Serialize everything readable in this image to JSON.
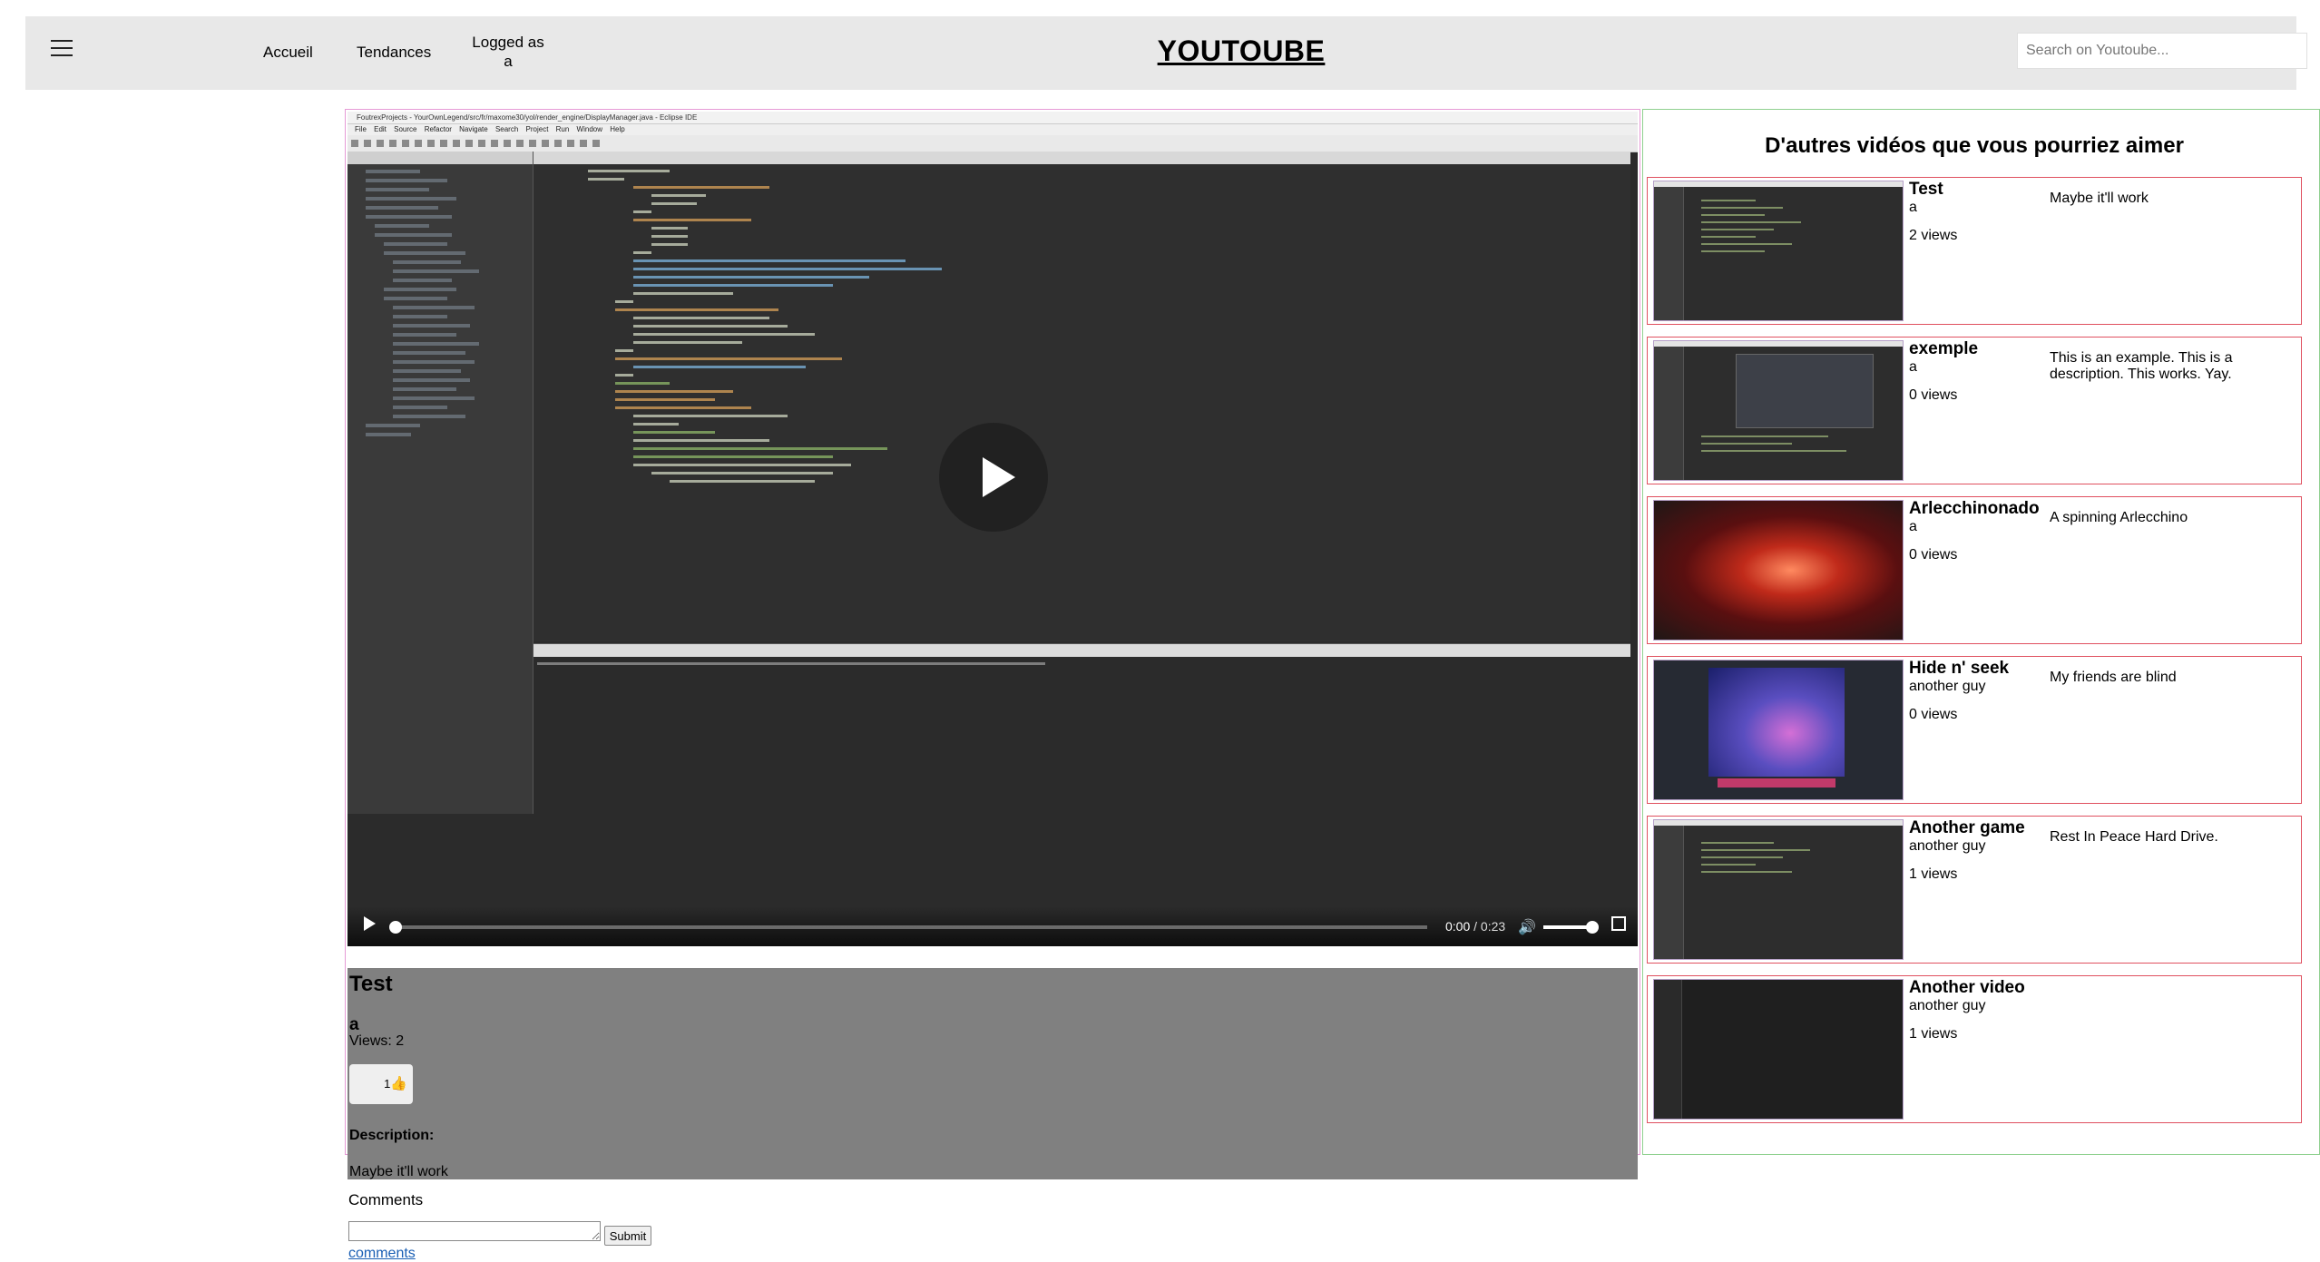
{
  "header": {
    "nav": {
      "home": "Accueil",
      "trending": "Tendances",
      "logged": "Logged as a"
    },
    "logo": "YOUTOUBE",
    "search_placeholder": "Search on Youtoube..."
  },
  "player": {
    "window_title": "FoutrexProjects - YourOwnLegend/src/fr/maxome30/yol/render_engine/DisplayManager.java - Eclipse IDE",
    "window_menu": "File Edit Source Refactor Navigate Search Project Run Window Help",
    "current_time": "0:00",
    "duration": "0:23",
    "progress": 0.0,
    "volume": 1.0
  },
  "video": {
    "title": "Test",
    "author": "a",
    "views": "Views: 2",
    "likes": "1",
    "description_label": "Description:",
    "description": "Maybe it'll work"
  },
  "comments": {
    "label": "Comments",
    "submit": "Submit",
    "link": "comments"
  },
  "sidebar": {
    "title": "D'autres vidéos que vous pourriez aimer",
    "videos": [
      {
        "title": "Test",
        "author": "a",
        "views": "2 views",
        "description": "Maybe it'll work",
        "thumb": "ide"
      },
      {
        "title": "exemple",
        "author": "a",
        "views": "0 views",
        "description": "This is an example. This is a description. This works. Yay.",
        "thumb": "ide"
      },
      {
        "title": "Arlecchinonado",
        "author": "a",
        "views": "0 views",
        "description": "A spinning Arlecchino",
        "thumb": "game"
      },
      {
        "title": "Hide n' seek",
        "author": "another guy",
        "views": "0 views",
        "description": "My friends are blind",
        "thumb": "seek"
      },
      {
        "title": "Another game",
        "author": "another guy",
        "views": "1 views",
        "description": "Rest In Peace Hard Drive.",
        "thumb": "ide"
      },
      {
        "title": "Another video",
        "author": "another guy",
        "views": "1 views",
        "description": "",
        "thumb": "dark"
      }
    ]
  }
}
